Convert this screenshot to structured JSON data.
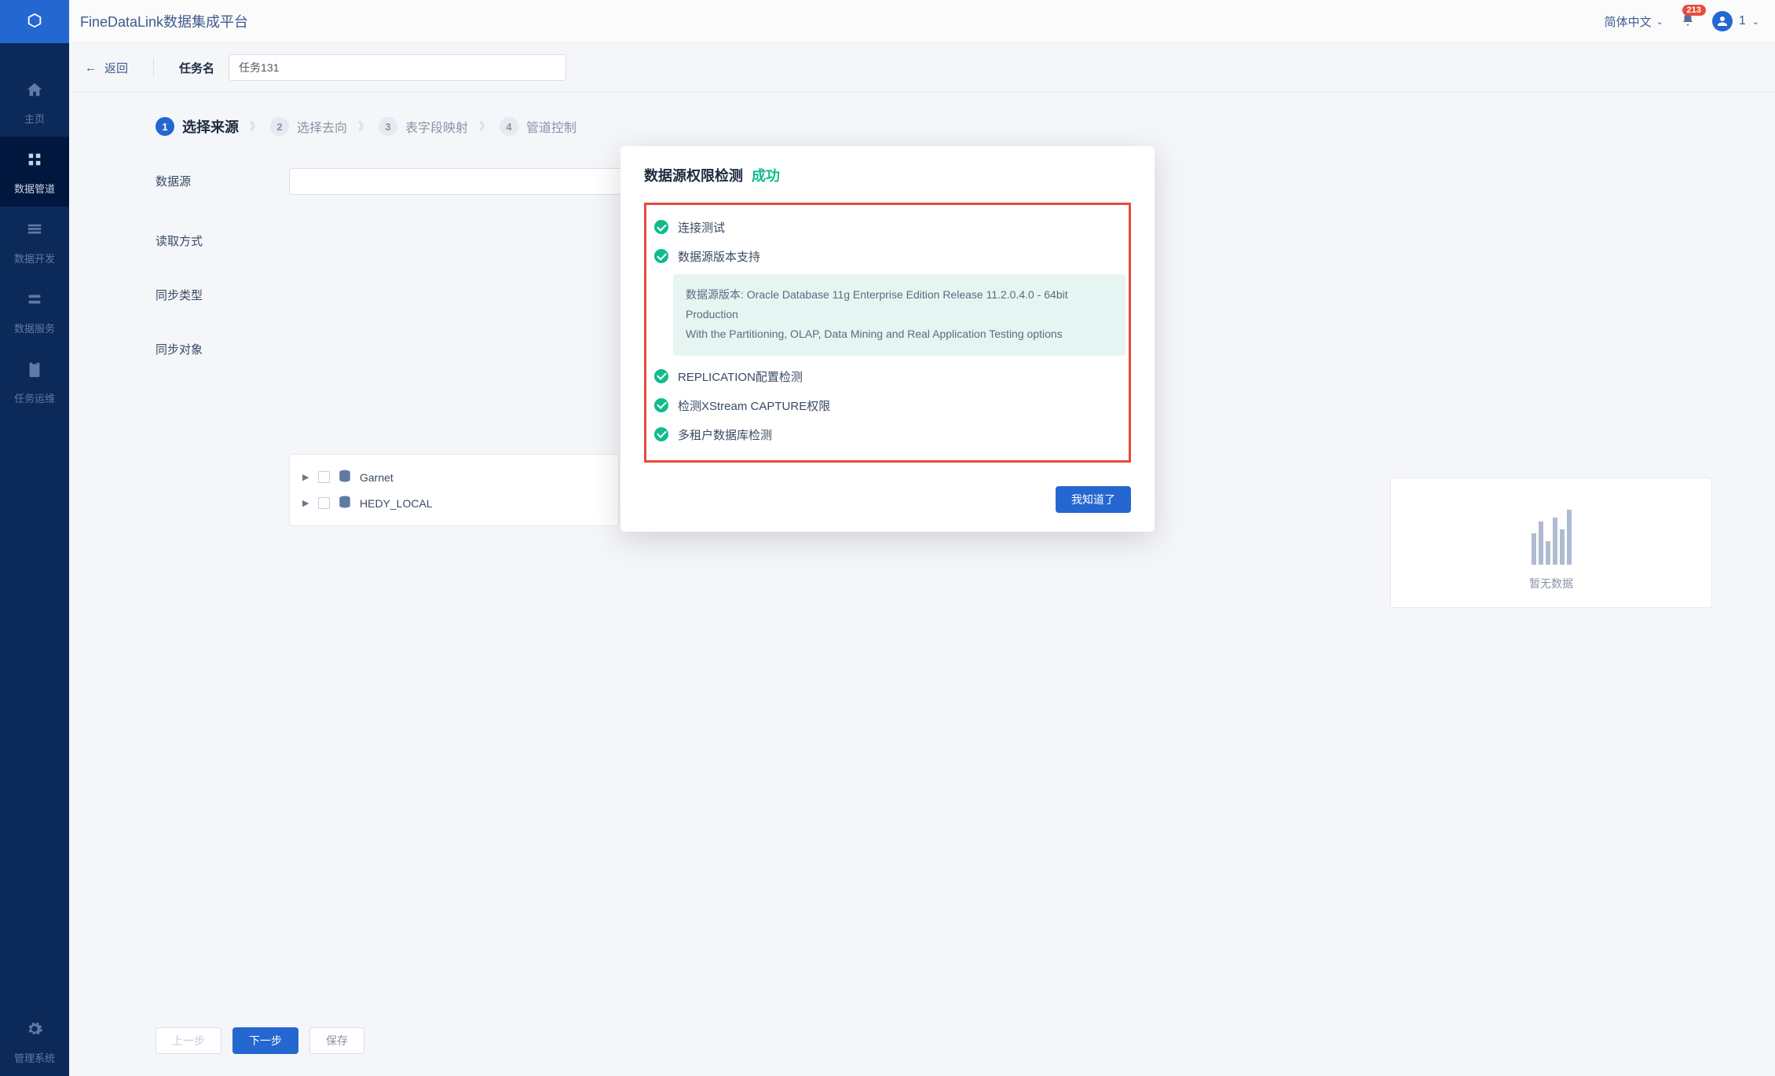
{
  "app": {
    "title": "FineDataLink数据集成平台"
  },
  "topbar": {
    "lang": "简体中文",
    "notif_count": "213",
    "user_label": "1"
  },
  "header": {
    "back": "返回",
    "task_label": "任务名",
    "task_value": "任务131"
  },
  "sidebar": {
    "items": [
      {
        "label": "主页"
      },
      {
        "label": "数据管道"
      },
      {
        "label": "数据开发"
      },
      {
        "label": "数据服务"
      },
      {
        "label": "任务运维"
      },
      {
        "label": "管理系统"
      }
    ]
  },
  "steps": [
    {
      "num": "1",
      "label": "选择来源"
    },
    {
      "num": "2",
      "label": "选择去向"
    },
    {
      "num": "3",
      "label": "表字段映射"
    },
    {
      "num": "4",
      "label": "管道控制"
    }
  ],
  "form": {
    "datasource_label": "数据源",
    "read_label": "读取方式",
    "synctype_label": "同步类型",
    "syncobj_label": "同步对象",
    "perm_link": "数据源权限检测"
  },
  "tree": [
    {
      "label": "Garnet"
    },
    {
      "label": "HEDY_LOCAL"
    }
  ],
  "nodata": "暂无数据",
  "buttons": {
    "prev": "上一步",
    "next": "下一步",
    "save": "保存"
  },
  "modal": {
    "title": "数据源权限检测",
    "status": "成功",
    "checks": [
      "连接测试",
      "数据源版本支持"
    ],
    "version_line1": "数据源版本: Oracle Database 11g Enterprise Edition Release 11.2.0.4.0 - 64bit Production",
    "version_line2": "With the Partitioning, OLAP, Data Mining and Real Application Testing options",
    "checks2": [
      "REPLICATION配置检测",
      "检测XStream CAPTURE权限",
      "多租户数据库检测"
    ],
    "ok": "我知道了"
  }
}
